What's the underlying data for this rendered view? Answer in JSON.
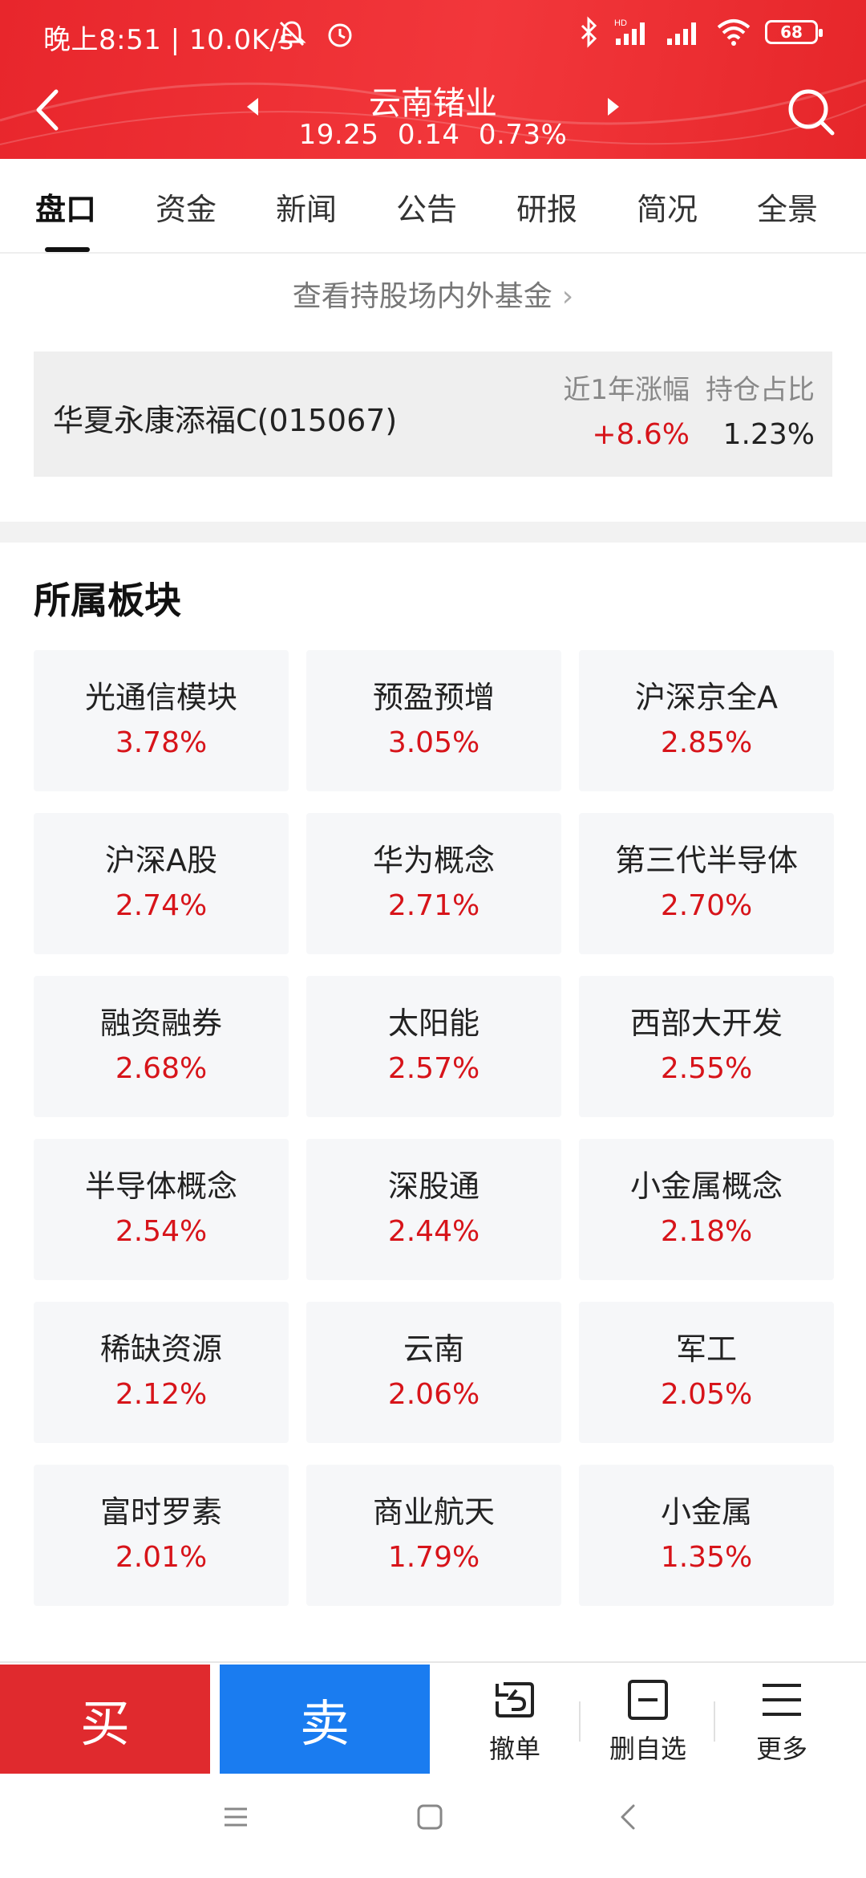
{
  "status_bar": {
    "time_speed": "晚上8:51 | 10.0K/s",
    "battery": "68"
  },
  "header": {
    "stock_name": "云南锗业",
    "price": "19.25",
    "change": "0.14",
    "change_pct": "0.73%"
  },
  "tabs": [
    "盘口",
    "资金",
    "新闻",
    "公告",
    "研报",
    "简况",
    "全景"
  ],
  "fund_link": "查看持股场内外基金",
  "fund": {
    "name": "华夏永康添福C(015067)",
    "return_label": "近1年涨幅",
    "return_value": "+8.6%",
    "ratio_label": "持仓占比",
    "ratio_value": "1.23%"
  },
  "sectors_title": "所属板块",
  "sectors": [
    {
      "name": "光通信模块",
      "pct": "3.78%"
    },
    {
      "name": "预盈预增",
      "pct": "3.05%"
    },
    {
      "name": "沪深京全A",
      "pct": "2.85%"
    },
    {
      "name": "沪深A股",
      "pct": "2.74%"
    },
    {
      "name": "华为概念",
      "pct": "2.71%"
    },
    {
      "name": "第三代半导体",
      "pct": "2.70%"
    },
    {
      "name": "融资融券",
      "pct": "2.68%"
    },
    {
      "name": "太阳能",
      "pct": "2.57%"
    },
    {
      "name": "西部大开发",
      "pct": "2.55%"
    },
    {
      "name": "半导体概念",
      "pct": "2.54%"
    },
    {
      "name": "深股通",
      "pct": "2.44%"
    },
    {
      "name": "小金属概念",
      "pct": "2.18%"
    },
    {
      "name": "稀缺资源",
      "pct": "2.12%"
    },
    {
      "name": "云南",
      "pct": "2.06%"
    },
    {
      "name": "军工",
      "pct": "2.05%"
    },
    {
      "name": "富时罗素",
      "pct": "2.01%"
    },
    {
      "name": "商业航天",
      "pct": "1.79%"
    },
    {
      "name": "小金属",
      "pct": "1.35%"
    }
  ],
  "actions": {
    "buy": "买",
    "sell": "卖",
    "cancel": "撤单",
    "remove_watch": "删自选",
    "more": "更多"
  },
  "colors": {
    "header_red": "#e8262c",
    "up_red": "#d7141a",
    "sell_blue": "#1a7cf0"
  },
  "icons": [
    "back-icon",
    "prev-arrow-icon",
    "next-arrow-icon",
    "search-icon",
    "undo-icon",
    "minus-square-icon",
    "menu-icon"
  ]
}
